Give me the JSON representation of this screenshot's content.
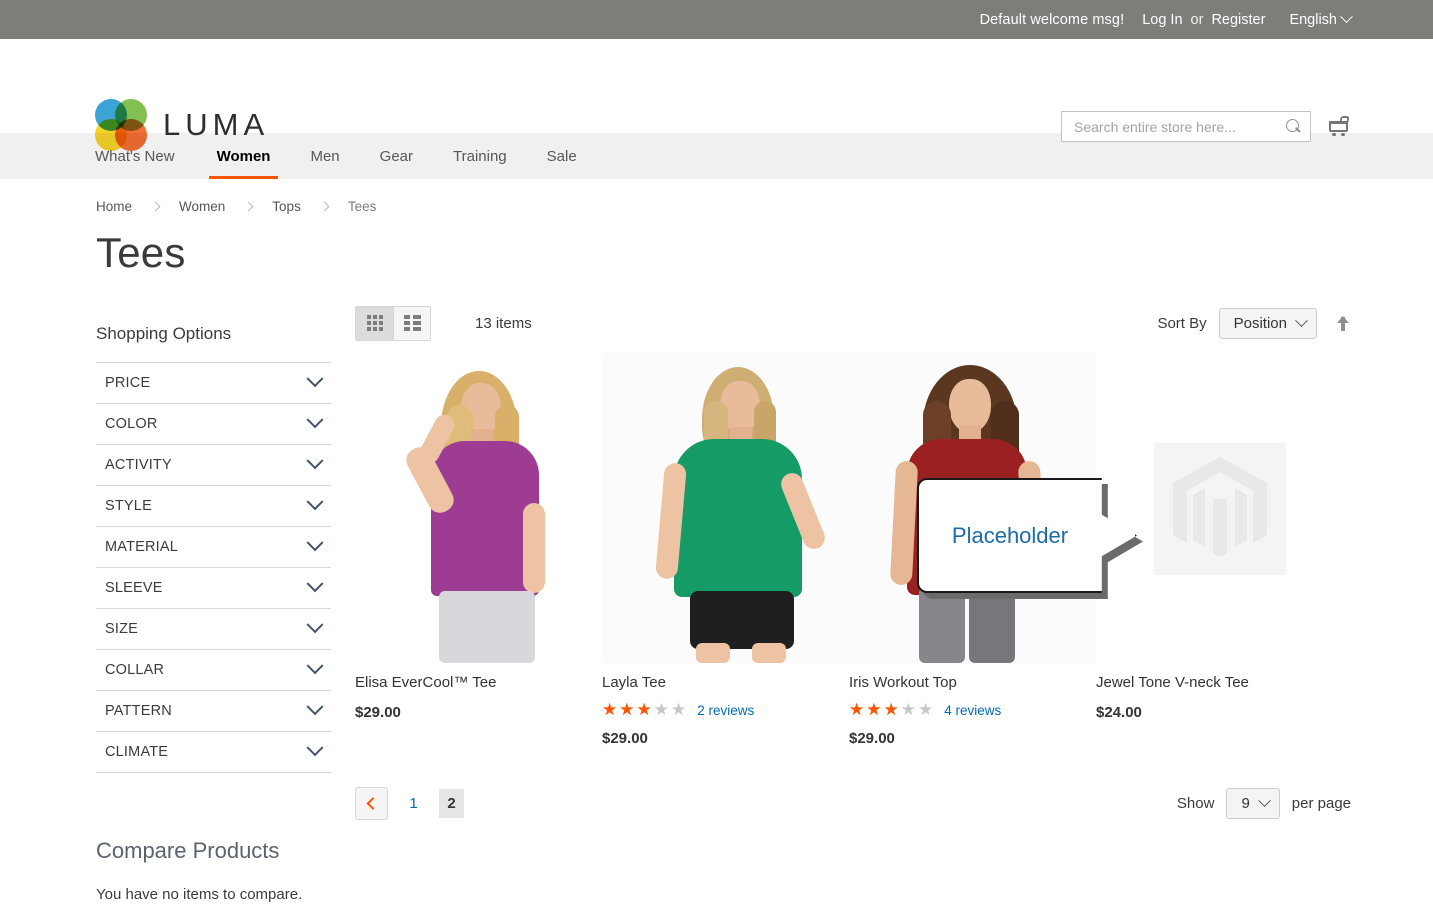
{
  "top_panel": {
    "welcome": "Default welcome msg!",
    "login": "Log In",
    "or": "or",
    "register": "Register",
    "language": "English"
  },
  "header": {
    "logo_text": "LUMA",
    "search_placeholder": "Search entire store here...",
    "search_value": ""
  },
  "nav": {
    "items": [
      {
        "label": "What's New",
        "active": false
      },
      {
        "label": "Women",
        "active": true
      },
      {
        "label": "Men",
        "active": false
      },
      {
        "label": "Gear",
        "active": false
      },
      {
        "label": "Training",
        "active": false
      },
      {
        "label": "Sale",
        "active": false
      }
    ]
  },
  "breadcrumb": [
    {
      "label": "Home"
    },
    {
      "label": "Women"
    },
    {
      "label": "Tops"
    },
    {
      "label": "Tees"
    }
  ],
  "page_title": "Tees",
  "sidebar": {
    "title": "Shopping Options",
    "filters": [
      {
        "label": "PRICE"
      },
      {
        "label": "COLOR"
      },
      {
        "label": "ACTIVITY"
      },
      {
        "label": "STYLE"
      },
      {
        "label": "MATERIAL"
      },
      {
        "label": "SLEEVE"
      },
      {
        "label": "SIZE"
      },
      {
        "label": "COLLAR"
      },
      {
        "label": "PATTERN"
      },
      {
        "label": "CLIMATE"
      }
    ],
    "compare_title": "Compare Products",
    "compare_empty": "You have no items to compare."
  },
  "toolbar": {
    "items_count": "13 items",
    "sort_by_label": "Sort By",
    "sort_value": "Position",
    "sort_direction": "ascending"
  },
  "products": [
    {
      "name": "Elisa EverCool™ Tee",
      "price": "$29.00",
      "rating_percent": 0,
      "reviews": "",
      "has_reviews": false,
      "image_type": "model-purple"
    },
    {
      "name": "Layla Tee",
      "price": "$29.00",
      "rating_percent": 60,
      "reviews": "2 reviews",
      "has_reviews": true,
      "image_type": "model-green"
    },
    {
      "name": "Iris Workout Top",
      "price": "$29.00",
      "rating_percent": 60,
      "reviews": "4 reviews",
      "has_reviews": true,
      "image_type": "model-red"
    },
    {
      "name": "Jewel Tone V-neck Tee",
      "price": "$24.00",
      "rating_percent": 0,
      "reviews": "",
      "has_reviews": false,
      "image_type": "placeholder"
    }
  ],
  "callout": {
    "text": "Placeholder"
  },
  "pagination": {
    "prev_label": "Previous",
    "pages": [
      {
        "label": "1",
        "current": false
      },
      {
        "label": "2",
        "current": true
      }
    ]
  },
  "bottom": {
    "show_label": "Show",
    "per_page_value": "9",
    "per_page_label": "per page"
  },
  "stars_glyphs": {
    "full": "★★★★★",
    "empty": "★★★★★"
  },
  "colors": {
    "accent_orange": "#ff5501",
    "link_blue": "#006bb4",
    "top_panel_bg": "#7d7d79",
    "nav_bg": "#f0f0f0",
    "callout_text": "#1b6ca8"
  }
}
